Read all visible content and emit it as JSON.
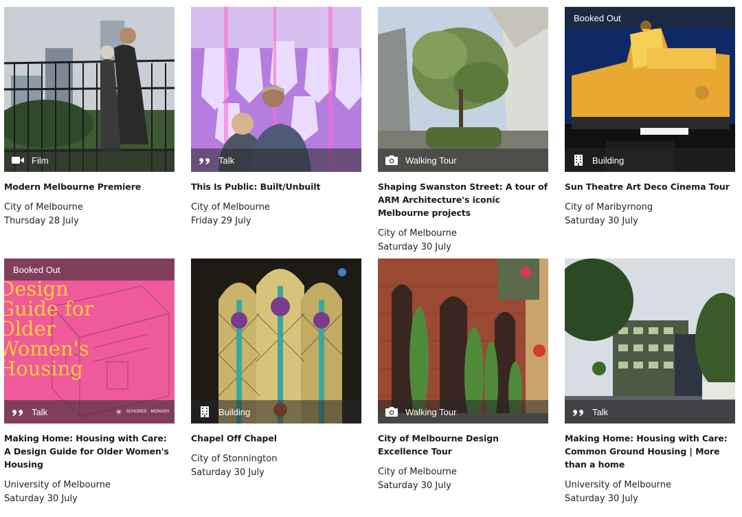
{
  "events": [
    {
      "title": "Modern Melbourne Premiere",
      "organiser": "City of Melbourne",
      "date": "Thursday 28 July",
      "category": "Film",
      "category_icon": "video-camera-icon",
      "booked": ""
    },
    {
      "title": "This Is Public: Built/Unbuilt",
      "organiser": "City of Melbourne",
      "date": "Friday 29 July",
      "category": "Talk",
      "category_icon": "quote-icon",
      "booked": ""
    },
    {
      "title": "Shaping Swanston Street: A tour of ARM Architecture's iconic Melbourne projects",
      "organiser": "City of Melbourne",
      "date": "Saturday 30 July",
      "category": "Walking Tour",
      "category_icon": "camera-icon",
      "booked": ""
    },
    {
      "title": "Sun Theatre Art Deco Cinema Tour",
      "organiser": "City of Maribyrnong",
      "date": "Saturday 30 July",
      "category": "Building",
      "category_icon": "building-icon",
      "booked": "Booked Out"
    },
    {
      "title": "Making Home: Housing with Care: A Design Guide for Older Women's Housing",
      "organiser": "University of Melbourne",
      "date": "Saturday 30 July",
      "category": "Talk",
      "category_icon": "quote-icon",
      "booked": "Booked Out",
      "poster_text": "Design Guide for Older Women's Housing",
      "logos": [
        "SCHORED",
        "MONASH"
      ]
    },
    {
      "title": "Chapel Off Chapel",
      "organiser": "City of Stonnington",
      "date": "Saturday 30 July",
      "category": "Building",
      "category_icon": "building-icon",
      "booked": ""
    },
    {
      "title": "City of Melbourne Design Excellence Tour",
      "organiser": "City of Melbourne",
      "date": "Saturday 30 July",
      "category": "Walking Tour",
      "category_icon": "camera-icon",
      "booked": ""
    },
    {
      "title": "Making Home: Housing with Care: Common Ground Housing | More than a home",
      "organiser": "University of Melbourne",
      "date": "Saturday 30 July",
      "category": "Talk",
      "category_icon": "quote-icon",
      "booked": ""
    }
  ]
}
